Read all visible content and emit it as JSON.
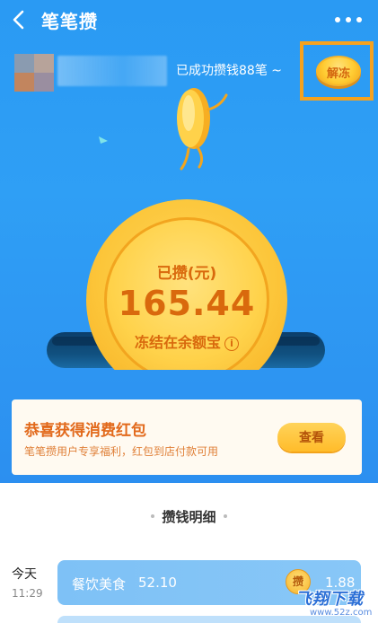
{
  "header": {
    "title": "笔笔攒",
    "back_icon": "chevron-left-icon",
    "more_icon": "more-dots-icon"
  },
  "user": {
    "success_text": "已成功攒钱88笔 ~",
    "unfreeze_label": "解冻"
  },
  "coin": {
    "saved_label": "已攒(元)",
    "amount": "165.44",
    "frozen_note": "冻结在余额宝",
    "info_glyph": "i"
  },
  "red_packet_card": {
    "title": "恭喜获得消费红包",
    "description": "笔笔攒用户专享福利，红包到店付款可用",
    "view_button": "查看"
  },
  "details": {
    "section_title": "攒钱明细",
    "records": [
      {
        "date": "今天",
        "time": "11:29",
        "category": "餐饮美食",
        "amount": "52.10",
        "coin_glyph": "攒",
        "saved": "1.88"
      }
    ]
  },
  "watermark": {
    "main": "飞翔下载",
    "sub": "www.52z.com"
  },
  "colors": {
    "hero_blue": "#2f9ff5",
    "accent_orange": "#e2691b",
    "coin_gold": "#ffd24a",
    "highlight_box": "#f6a21e"
  }
}
